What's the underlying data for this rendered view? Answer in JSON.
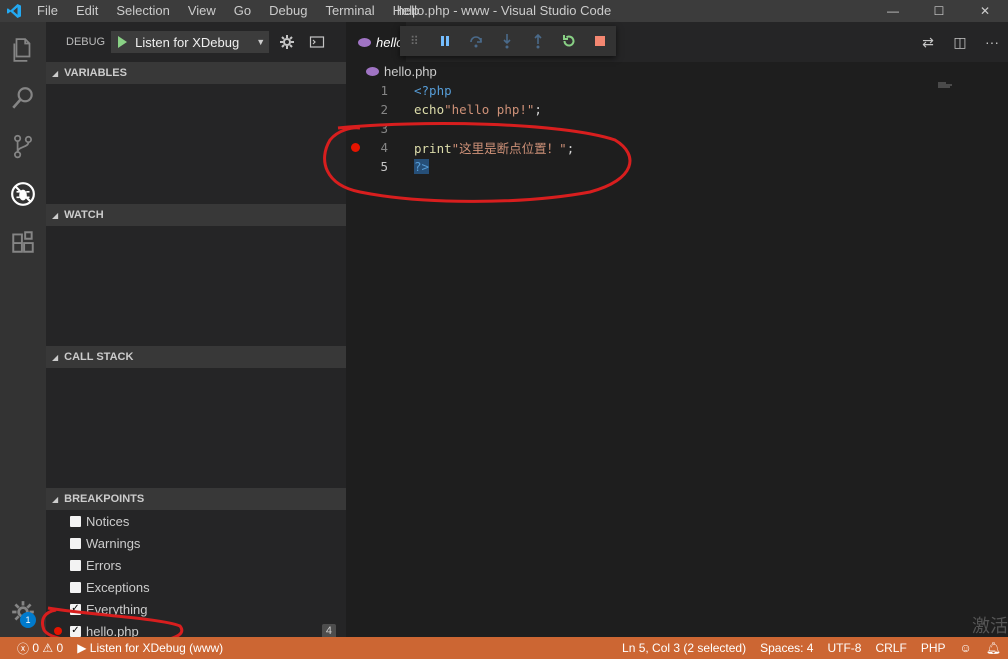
{
  "window": {
    "title": "hello.php - www - Visual Studio Code",
    "menu": [
      "File",
      "Edit",
      "Selection",
      "View",
      "Go",
      "Debug",
      "Terminal",
      "Help"
    ],
    "controls": [
      "—",
      "☐",
      "✕"
    ]
  },
  "activity": {
    "icons": [
      "files-icon",
      "search-icon",
      "source-control-icon",
      "debug-icon",
      "extensions-icon"
    ],
    "badge": "1"
  },
  "sidebar": {
    "debug_label": "DEBUG",
    "config_name": "Listen for XDebug",
    "sections": {
      "variables": "VARIABLES",
      "watch": "WATCH",
      "call_stack": "CALL STACK",
      "breakpoints": "BREAKPOINTS"
    },
    "breakpoints": [
      {
        "label": "Notices",
        "checked": false
      },
      {
        "label": "Warnings",
        "checked": false
      },
      {
        "label": "Errors",
        "checked": false
      },
      {
        "label": "Exceptions",
        "checked": false
      },
      {
        "label": "Everything",
        "checked": true
      },
      {
        "label": "hello.php",
        "checked": true,
        "line": "4"
      }
    ]
  },
  "editor": {
    "tab_label": "hello",
    "breadcrumb": "hello.php",
    "lines": [
      {
        "num": "1",
        "parts": [
          {
            "t": "<?php",
            "c": "kw-tag"
          }
        ]
      },
      {
        "num": "2",
        "parts": [
          {
            "t": "echo",
            "c": "fn"
          },
          {
            "t": "\"hello php!\"",
            "c": "str"
          },
          {
            "t": ";",
            "c": "plain"
          }
        ]
      },
      {
        "num": "3",
        "parts": []
      },
      {
        "num": "4",
        "parts": [
          {
            "t": "print",
            "c": "fn"
          },
          {
            "t": "\"这里是断点位置！\"",
            "c": "str"
          },
          {
            "t": ";",
            "c": "plain"
          }
        ]
      },
      {
        "num": "5",
        "parts": [
          {
            "t": "?>",
            "c": "kw-tag sel"
          }
        ]
      }
    ],
    "breakpoint_line": "4"
  },
  "statusbar": {
    "errors": "0",
    "warnings": "0",
    "debug_session": "Listen for XDebug (www)",
    "position": "Ln 5, Col 3 (2 selected)",
    "spaces": "Spaces: 4",
    "encoding": "UTF-8",
    "eol": "CRLF",
    "language": "PHP",
    "color": "#cc6633"
  },
  "watermark": "激活"
}
